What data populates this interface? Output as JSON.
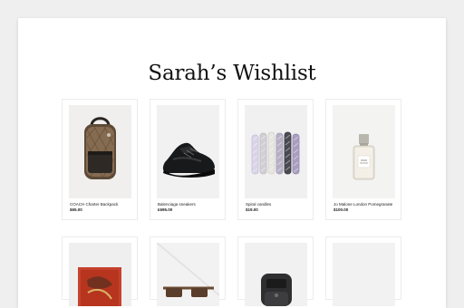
{
  "wishlist": {
    "title": "Sarah’s Wishlist",
    "items": [
      {
        "name": "COACH  Charter Backpack",
        "price": "$65.00",
        "icon": "backpack-image"
      },
      {
        "name": "Balenciaga sneakers",
        "price": "£695.00",
        "icon": "sneaker-image"
      },
      {
        "name": "Spiral candles",
        "price": "$19.00",
        "icon": "candles-image"
      },
      {
        "name": "Jo Malone London Pomegranate",
        "price": "$100.00",
        "icon": "perfume-bottle-image"
      },
      {
        "icon": "scarf-image"
      },
      {
        "icon": "sunglasses-image"
      },
      {
        "icon": "air-fryer-image"
      },
      {
        "icon": "blank-product-image"
      }
    ]
  },
  "colors": {
    "page_background": "#efefef",
    "card_background": "#ffffff",
    "image_background": "#f2f2f2"
  }
}
